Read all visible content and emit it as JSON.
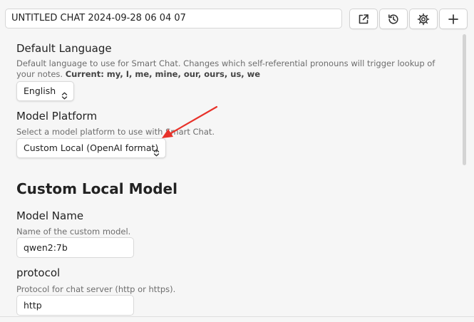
{
  "header": {
    "chat_title": "UNTITLED CHAT 2024-09-28 06 04 07",
    "buttons": [
      {
        "icon": "external-link-icon"
      },
      {
        "icon": "history-icon"
      },
      {
        "icon": "gear-icon"
      },
      {
        "icon": "plus-icon"
      }
    ]
  },
  "settings": {
    "default_language": {
      "name": "Default Language",
      "description": "Default language to use for Smart Chat. Changes which self-referential pronouns will trigger lookup of your notes.",
      "current_label": "Current: my, I, me, mine, our, ours, us, we",
      "selected": "English"
    },
    "model_platform": {
      "name": "Model Platform",
      "description": "Select a model platform to use with Smart Chat.",
      "selected": "Custom Local (OpenAI format)"
    },
    "section_title": "Custom Local Model",
    "model_name": {
      "name": "Model Name",
      "description": "Name of the custom model.",
      "value": "qwen2:7b"
    },
    "protocol": {
      "name": "protocol",
      "description": "Protocol for chat server (http or https).",
      "value": "http"
    }
  },
  "annotation": {
    "arrow_color": "#e8322a"
  }
}
